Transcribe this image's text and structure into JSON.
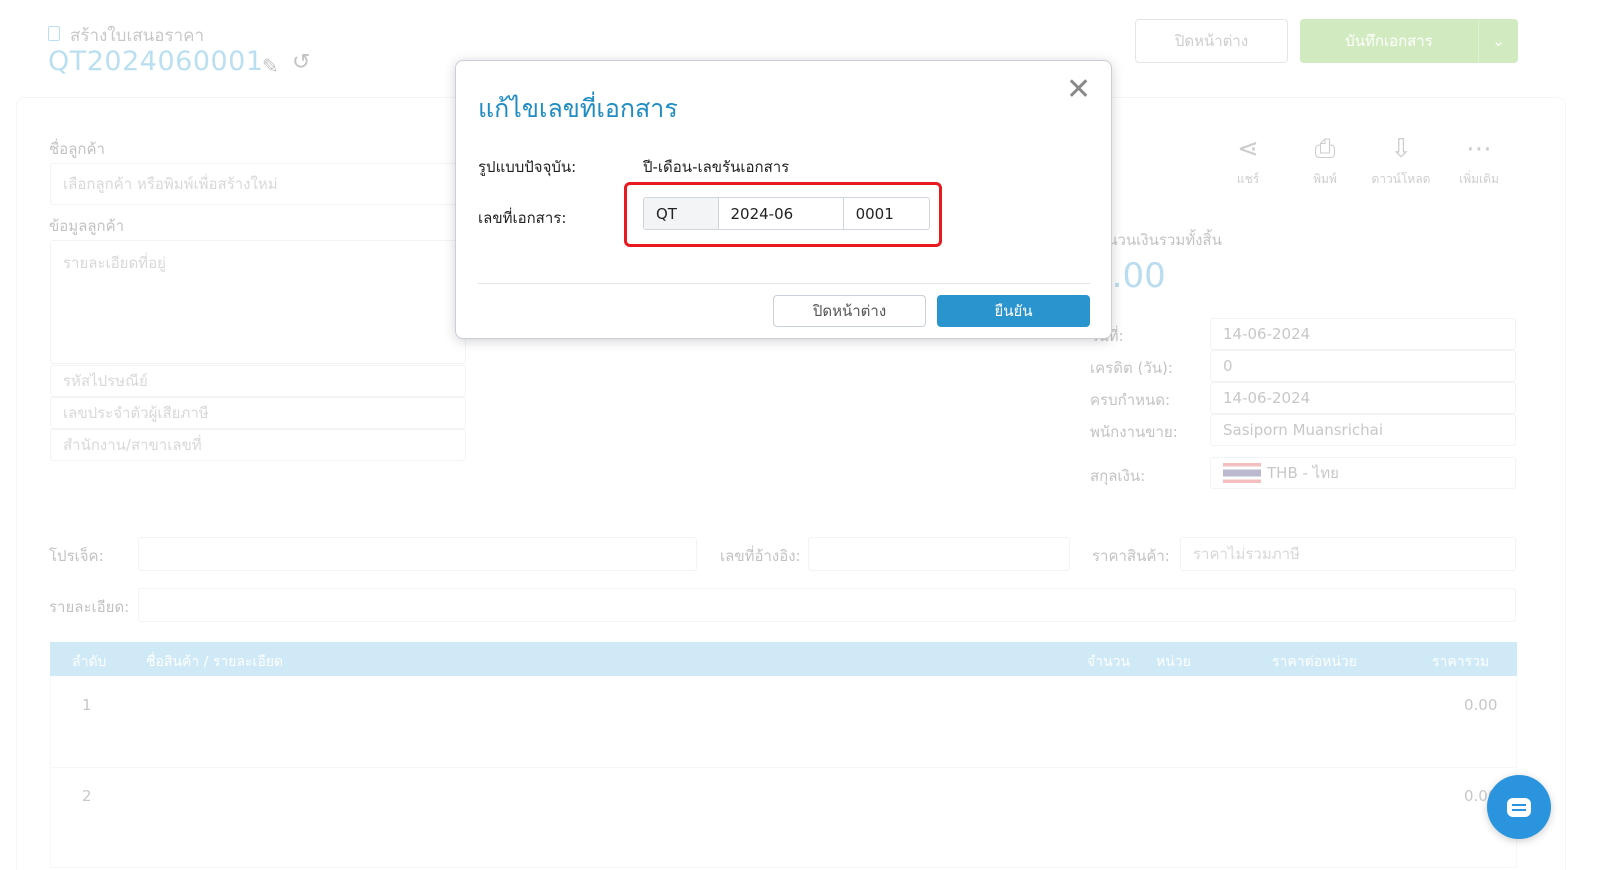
{
  "header": {
    "subtitle": "สร้างใบเสนอราคา",
    "doc_number": "QT2024060001",
    "close_label": "ปิดหน้าต่าง",
    "save_label": "บันทึกเอกสาร"
  },
  "customer": {
    "name_label": "ชื่อลูกค้า",
    "name_placeholder": "เลือกลูกค้า หรือพิมพ์เพื่อสร้างใหม่",
    "info_label": "ข้อมูลลูกค้า",
    "address_placeholder": "รายละเอียดที่อยู่",
    "postcode_placeholder": "รหัสไปรษณีย์",
    "taxid_placeholder": "เลขประจำตัวผู้เสียภาษี",
    "branch_placeholder": "สำนักงาน/สาขาเลขที่"
  },
  "tools": [
    {
      "label": "แชร์",
      "icon": "share-icon"
    },
    {
      "label": "พิมพ์",
      "icon": "print-icon"
    },
    {
      "label": "ดาวน์โหลด",
      "icon": "download-pdf-icon"
    },
    {
      "label": "เพิ่มเติม",
      "icon": "more-icon"
    }
  ],
  "summary": {
    "total_label": "จำนวนเงินรวมทั้งสิ้น",
    "total_value": "0.00",
    "date_label": "วันที่:",
    "date_value": "14-06-2024",
    "credit_label": "เครดิต (วัน):",
    "credit_value": "0",
    "due_label": "ครบกำหนด:",
    "due_value": "14-06-2024",
    "sales_label": "พนักงานขาย:",
    "sales_value": "Sasiporn Muansrichai",
    "currency_label": "สกุลเงิน:",
    "currency_value": "THB - ไทย"
  },
  "project": {
    "project_label": "โปรเจ็ค:",
    "ref_label": "เลขที่อ้างอิง:",
    "price_label": "ราคาสินค้า:",
    "price_value": "ราคาไม่รวมภาษี",
    "detail_label": "รายละเอียด:"
  },
  "table": {
    "headers": [
      "ลำดับ",
      "ชื่อสินค้า / รายละเอียด",
      "จำนวน",
      "หน่วย",
      "ราคาต่อหน่วย",
      "ราคารวม"
    ],
    "rows": [
      {
        "no": "1",
        "total": "0.00"
      },
      {
        "no": "2",
        "total": "0.00"
      }
    ]
  },
  "modal": {
    "title": "แก้ไขเลขที่เอกสาร",
    "format_label": "รูปแบบปัจจุบัน:",
    "format_value": "ปี-เดือน-เลขรันเอกสาร",
    "docno_label": "เลขที่เอกสาร:",
    "prefix": "QT",
    "period": "2024-06",
    "running": "0001",
    "cancel_label": "ปิดหน้าต่าง",
    "confirm_label": "ยืนยัน"
  },
  "colors": {
    "accent": "#2a94cf",
    "highlight": "#e8191f",
    "save_green": "#72c13e"
  }
}
